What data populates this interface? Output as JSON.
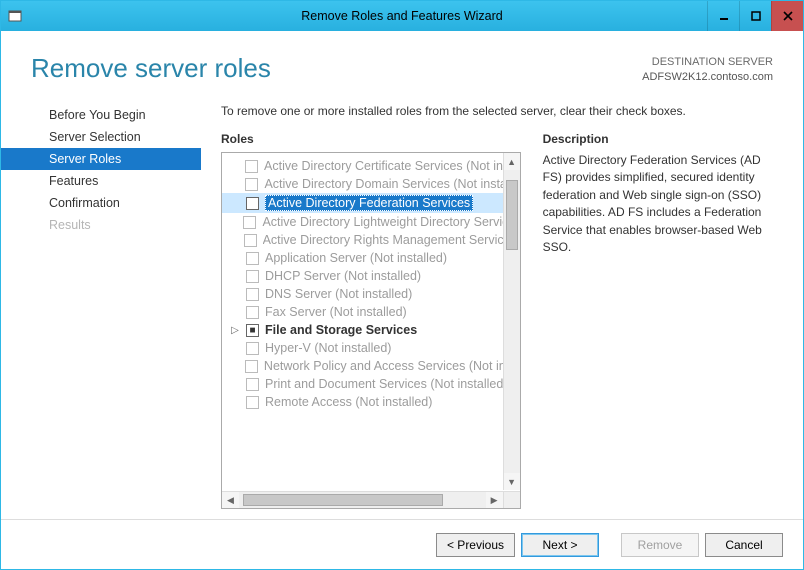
{
  "window": {
    "title": "Remove Roles and Features Wizard"
  },
  "page": {
    "title": "Remove server roles",
    "destination_label": "DESTINATION SERVER",
    "destination_value": "ADFSW2K12.contoso.com",
    "instruction": "To remove one or more installed roles from the selected server, clear their check boxes."
  },
  "sidebar": {
    "items": [
      {
        "label": "Before You Begin",
        "active": false,
        "disabled": false
      },
      {
        "label": "Server Selection",
        "active": false,
        "disabled": false
      },
      {
        "label": "Server Roles",
        "active": true,
        "disabled": false
      },
      {
        "label": "Features",
        "active": false,
        "disabled": false
      },
      {
        "label": "Confirmation",
        "active": false,
        "disabled": false
      },
      {
        "label": "Results",
        "active": false,
        "disabled": true
      }
    ]
  },
  "sections": {
    "roles_label": "Roles",
    "description_label": "Description"
  },
  "roles": [
    {
      "label": "Active Directory Certificate Services (Not installed)",
      "enabled": false
    },
    {
      "label": "Active Directory Domain Services (Not installed)",
      "enabled": false
    },
    {
      "label": "Active Directory Federation Services",
      "enabled": true,
      "selected": true
    },
    {
      "label": "Active Directory Lightweight Directory Services (Not installed)",
      "enabled": false
    },
    {
      "label": "Active Directory Rights Management Services (Not installed)",
      "enabled": false
    },
    {
      "label": "Application Server (Not installed)",
      "enabled": false
    },
    {
      "label": "DHCP Server (Not installed)",
      "enabled": false
    },
    {
      "label": "DNS Server (Not installed)",
      "enabled": false
    },
    {
      "label": "Fax Server (Not installed)",
      "enabled": false
    },
    {
      "label": "File and Storage Services",
      "enabled": true,
      "expandable": true,
      "checkstate": "mixed",
      "bold": true
    },
    {
      "label": "Hyper-V (Not installed)",
      "enabled": false
    },
    {
      "label": "Network Policy and Access Services (Not installed)",
      "enabled": false
    },
    {
      "label": "Print and Document Services (Not installed)",
      "enabled": false
    },
    {
      "label": "Remote Access (Not installed)",
      "enabled": false
    }
  ],
  "description": {
    "text": "Active Directory Federation Services (AD FS) provides simplified, secured identity federation and Web single sign-on (SSO) capabilities. AD FS includes a Federation Service that enables browser-based Web SSO."
  },
  "footer": {
    "previous": "< Previous",
    "next": "Next >",
    "remove": "Remove",
    "cancel": "Cancel"
  }
}
